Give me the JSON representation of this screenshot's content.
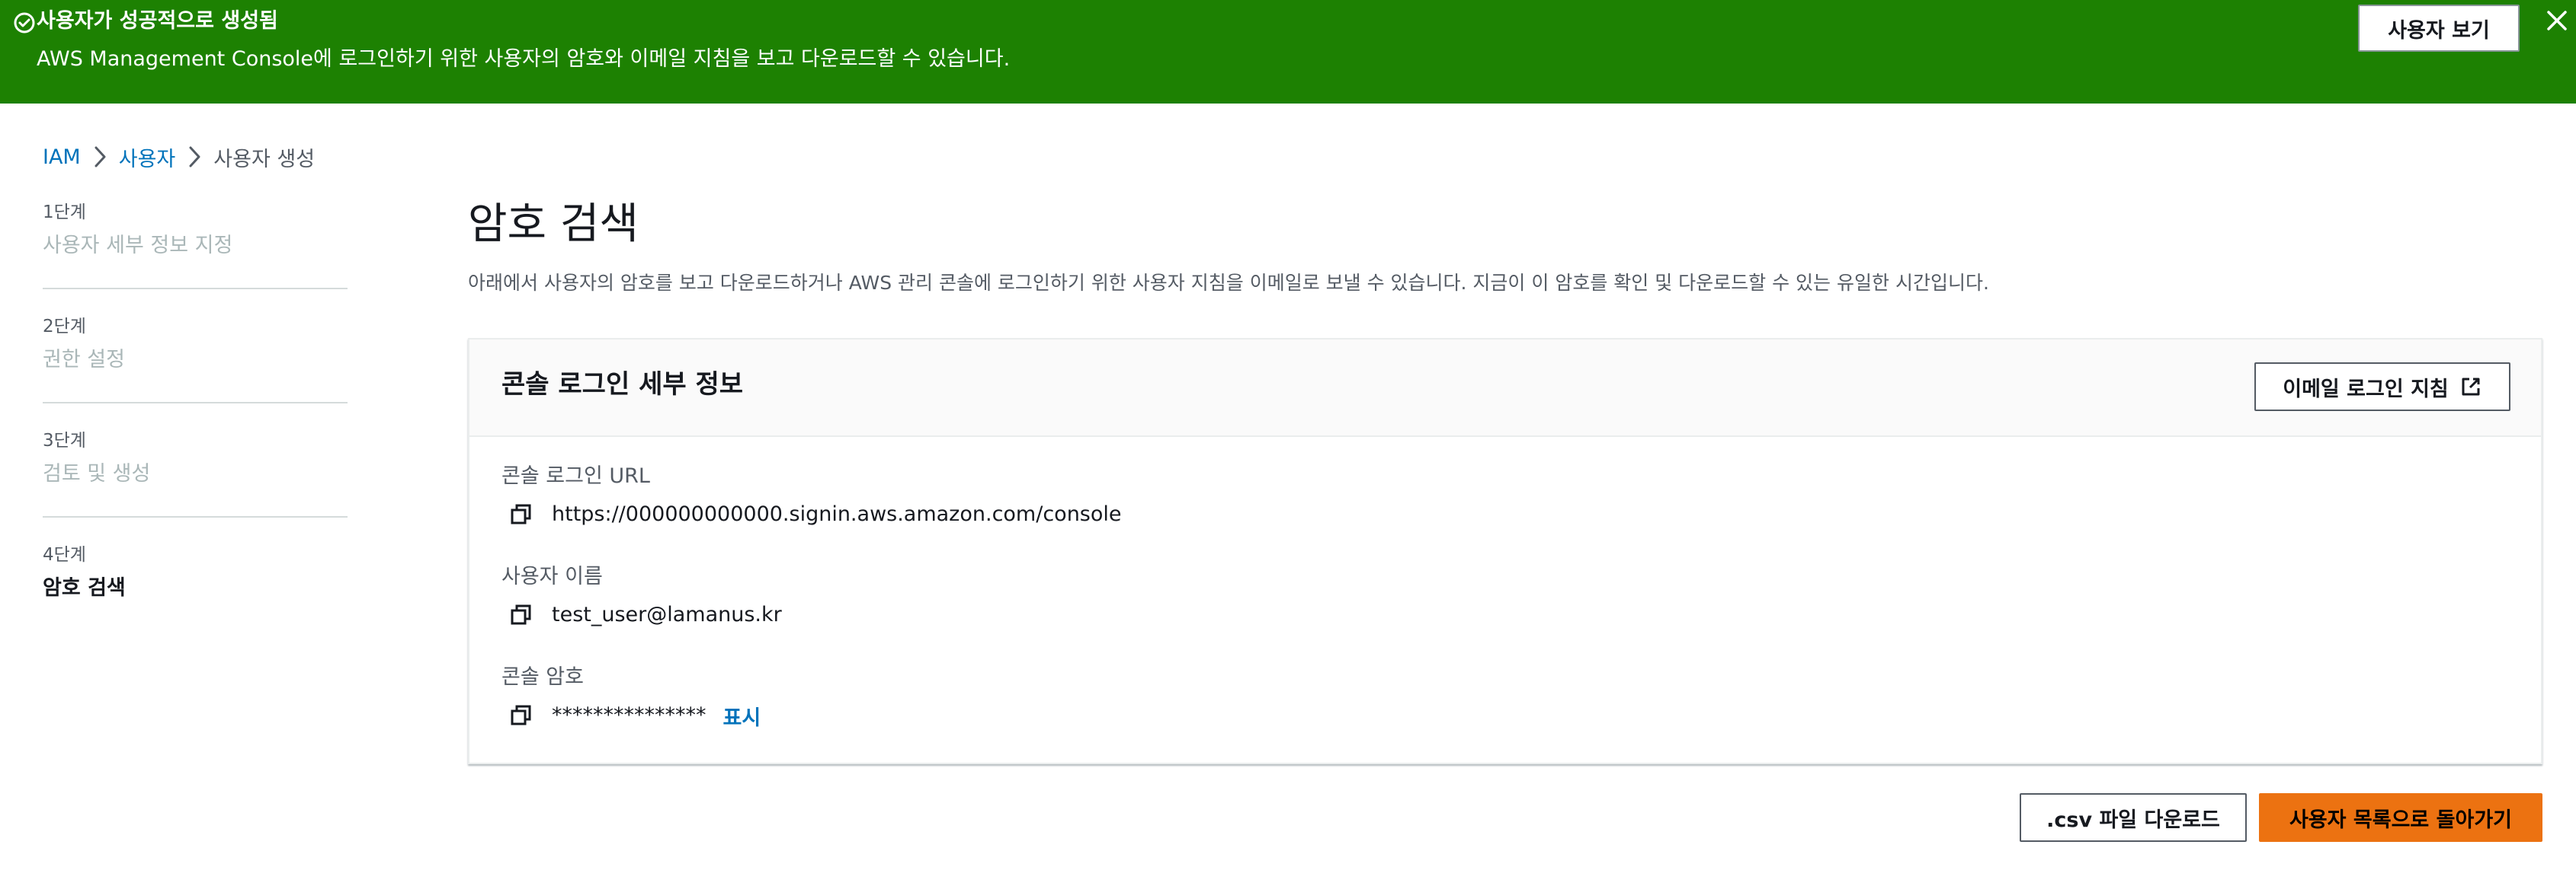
{
  "flash": {
    "title": "사용자가 성공적으로 생성됨",
    "description": "AWS Management Console에 로그인하기 위한 사용자의 암호와 이메일 지침을 보고 다운로드할 수 있습니다.",
    "view_user_label": "사용자 보기",
    "icon": "success-check-icon",
    "close_icon": "close-icon",
    "color": "#1d8102"
  },
  "breadcrumb": [
    {
      "label": "IAM",
      "link": true
    },
    {
      "label": "사용자",
      "link": true
    },
    {
      "label": "사용자 생성",
      "link": false
    }
  ],
  "steps": [
    {
      "number": "1단계",
      "name": "사용자 세부 정보 지정",
      "active": false
    },
    {
      "number": "2단계",
      "name": "권한 설정",
      "active": false
    },
    {
      "number": "3단계",
      "name": "검토 및 생성",
      "active": false
    },
    {
      "number": "4단계",
      "name": "암호 검색",
      "active": true
    }
  ],
  "main": {
    "title": "암호 검색",
    "description": "아래에서 사용자의 암호를 보고 다운로드하거나 AWS 관리 콘솔에 로그인하기 위한 사용자 지침을 이메일로 보낼 수 있습니다. 지금이 이 암호를 확인 및 다운로드할 수 있는 유일한 시간입니다."
  },
  "login_details": {
    "header": "콘솔 로그인 세부 정보",
    "email_button_label": "이메일 로그인 지침",
    "email_button_icon": "external-link-icon",
    "url_label": "콘솔 로그인 URL",
    "url_value": "https://000000000000.signin.aws.amazon.com/console",
    "username_label": "사용자 이름",
    "username_value": "test_user@lamanus.kr",
    "password_label": "콘솔 암호",
    "password_value": "***************",
    "show_label": "표시",
    "copy_icon": "copy-icon"
  },
  "footer": {
    "csv_label": ".csv 파일 다운로드",
    "back_label": "사용자 목록으로 돌아가기",
    "primary_color": "#ec7211"
  }
}
